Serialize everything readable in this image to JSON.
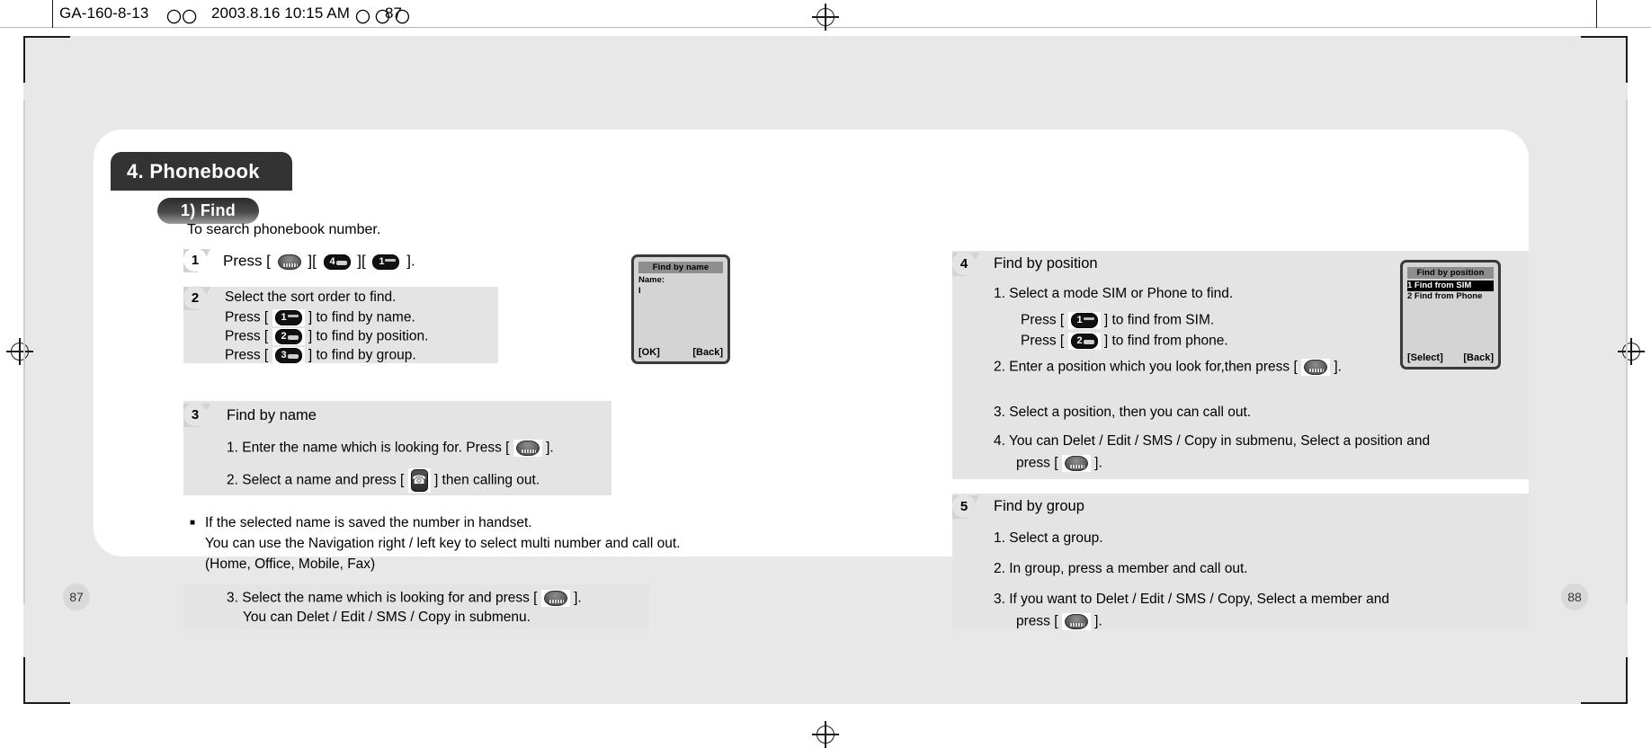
{
  "print_header": {
    "doc_code": "GA-160-8-13",
    "cjk_1": "〇〇",
    "date": "2003.8.16 10:15 AM",
    "cjk_2": "〇 〇 〇",
    "page_ref": "87"
  },
  "chapter": {
    "label": "4. Phonebook"
  },
  "section": {
    "label": "1) Find"
  },
  "intro": "To search phonebook number.",
  "left_column": {
    "step1": {
      "number": "1",
      "prefix": "Press [",
      "sep1": "][",
      "sep2": "][",
      "suffix": "].",
      "keys": [
        "ok-key",
        "4-key",
        "1-key"
      ]
    },
    "step2": {
      "number": "2",
      "lines": [
        {
          "text": "Select the sort order to find."
        },
        {
          "pre": "Press [",
          "key": "1-key",
          "post": "] to find by name."
        },
        {
          "pre": "Press [",
          "key": "2-key",
          "post": "] to find by position."
        },
        {
          "pre": "Press [",
          "key": "3-key",
          "post": "] to find by group."
        }
      ]
    },
    "step3": {
      "number": "3",
      "heading": "Find by name",
      "lines": [
        {
          "pre": "1. Enter the name which is looking for. Press [",
          "key": "ok-key",
          "post": "]."
        },
        {
          "pre": "2. Select a name and press [",
          "key": "send-key",
          "post": "] then calling out."
        }
      ]
    },
    "note": {
      "bullet": "■",
      "lines": [
        "If the selected name is saved the number in handset.",
        "You can use the Navigation right / left key to select multi number  and call out.",
        "(Home, Office, Mobile, Fax)"
      ]
    },
    "step3_cont": {
      "lines": [
        {
          "pre": "3. Select the name which is looking for and press [",
          "key": "ok-key",
          "post": "]."
        },
        {
          "plain": "You can Delet / Edit / SMS / Copy in submenu."
        }
      ]
    }
  },
  "right_column": {
    "step4": {
      "number": "4",
      "heading": "Find by position",
      "lines": [
        {
          "plain": "1. Select a mode SIM or Phone to find."
        },
        {
          "pre": "Press [",
          "key": "1-key",
          "post": "] to find from SIM."
        },
        {
          "pre": "Press [",
          "key": "2-key",
          "post": "] to find from phone."
        },
        {
          "pre": "2. Enter a position which you look for,then press [",
          "key": "ok-key",
          "post": "]."
        },
        {
          "plain": "3. Select a position, then you can call out."
        },
        {
          "plain": "4. You can Delet / Edit / SMS / Copy in submenu, Select a position and"
        },
        {
          "pre": "press [",
          "key": "ok-key",
          "post": "]."
        }
      ]
    },
    "step5": {
      "number": "5",
      "heading": "Find by group",
      "lines": [
        {
          "plain": "1. Select a group."
        },
        {
          "plain": "2. In group, press a member and call out."
        },
        {
          "plain": "3. If you want to Delet / Edit / SMS / Copy, Select a member and"
        },
        {
          "pre": "press [",
          "key": "ok-key",
          "post": "]."
        }
      ]
    }
  },
  "lcd_left": {
    "title": "Find by name",
    "label": "Name:",
    "caret": "I",
    "softkey_left": "[OK]",
    "softkey_right": "[Back]"
  },
  "lcd_right": {
    "title": "Find by position",
    "items": [
      {
        "text": "1 Find from SIM",
        "selected": true
      },
      {
        "text": "2 Find from Phone",
        "selected": false
      }
    ],
    "softkey_left": "[Select]",
    "softkey_right": "[Back]"
  },
  "folios": {
    "left": "87",
    "right": "88"
  },
  "colors": {
    "page_grey": "#e8e8e8",
    "block_grey": "#e4e4e4",
    "chapter_dark": "#333333",
    "lcd_grey": "#d4d4d4",
    "lcd_title_grey": "#8e8e8e"
  }
}
